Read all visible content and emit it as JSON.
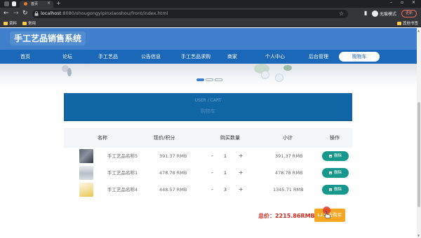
{
  "browser": {
    "tab_title": "首页",
    "url_host": "localhost",
    "url_path": ":8080/shougongyipinxiaoshou/front/index.html",
    "incognito_label": "无痕模式",
    "update_label": "更新",
    "bookmarks": [
      "资料",
      "常用"
    ],
    "bookmarks_right": "其他书签"
  },
  "site": {
    "title": "手工艺品销售系统",
    "nav": [
      "首页",
      "论坛",
      "手工艺品",
      "公告信息",
      "手工艺品求购",
      "商家",
      "个人中心",
      "后台管理"
    ],
    "nav_active": "购物车"
  },
  "section": {
    "title_en": "USER / CART",
    "title_cn": "购物车"
  },
  "cart": {
    "columns": [
      "名称",
      "现价/积分",
      "购买数量",
      "小计",
      "操作"
    ],
    "rows": [
      {
        "name": "手工艺品名称5",
        "price": "391.37 RMB",
        "qty": "1",
        "subtotal": "391.37 RMB",
        "delete": "删除"
      },
      {
        "name": "手工艺品名称1",
        "price": "478.78 RMB",
        "qty": "1",
        "subtotal": "478.78 RMB",
        "delete": "删除"
      },
      {
        "name": "手工艺品名称4",
        "price": "448.57 RMB",
        "qty": "3",
        "subtotal": "1345.71 RMB",
        "delete": "删除"
      }
    ],
    "total_label": "总价：",
    "total_value": "2215.86RMB",
    "buy_label": "点击购买"
  },
  "colors": {
    "header": "#3f7fcc",
    "navbar": "#1b68b8",
    "title_box": "#1166a6",
    "delete_button": "#16978b",
    "buy_button": "#f5a623",
    "total_text": "#d9261c"
  },
  "icons": [
    "back-icon",
    "forward-icon",
    "reload-icon",
    "lock-icon",
    "star-icon",
    "sidebar-icon",
    "incognito-icon",
    "trash-icon",
    "cart-icon",
    "folder-icon",
    "cursor-icon"
  ]
}
